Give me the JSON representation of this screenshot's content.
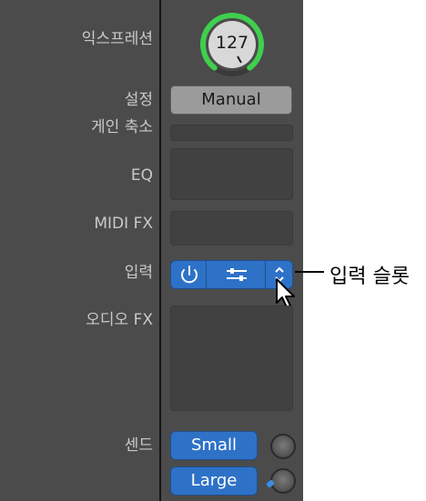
{
  "labels": {
    "expression": "익스프레션",
    "setting": "설정",
    "gain_reduction": "게인 축소",
    "eq": "EQ",
    "midi_fx": "MIDI FX",
    "input": "입력",
    "audio_fx": "오디오 FX",
    "send": "센드"
  },
  "expression_knob": {
    "value": "127",
    "level": 1.0
  },
  "setting_button": {
    "label": "Manual"
  },
  "sends": [
    {
      "label": "Small"
    },
    {
      "label": "Large"
    }
  ],
  "callout": {
    "text": "입력 슬롯"
  },
  "icons": {
    "power": "power-icon",
    "sliders": "sliders-icon",
    "updown": "chevron-updown-icon",
    "cursor": "cursor-arrow-icon"
  },
  "colors": {
    "panel": "#4b4b4b",
    "blue": "#2e72c7",
    "knob_ring": "#3fcf4e",
    "label": "#c9c9c9"
  }
}
